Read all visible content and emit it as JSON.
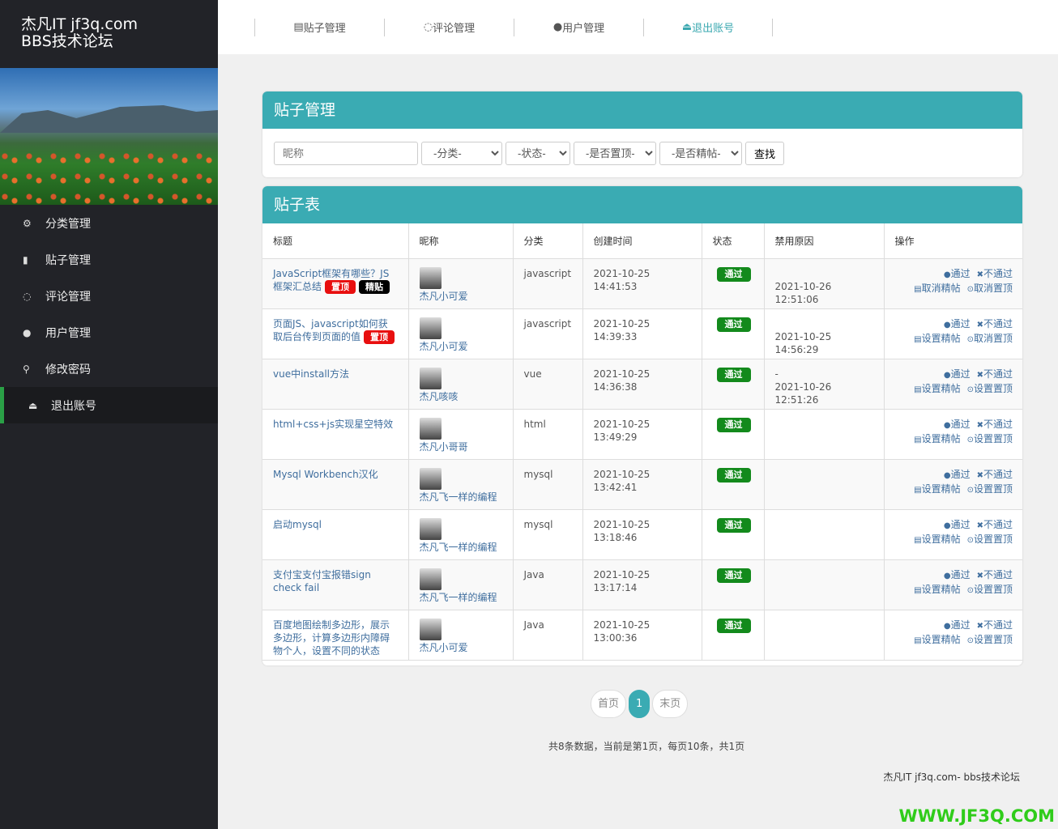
{
  "brand": {
    "line1": "杰凡IT jf3q.com",
    "line2": "BBS技术论坛"
  },
  "sidebar": {
    "items": [
      {
        "label": "分类管理",
        "icon": "⚙"
      },
      {
        "label": "贴子管理",
        "icon": "▮"
      },
      {
        "label": "评论管理",
        "icon": "◌"
      },
      {
        "label": "用户管理",
        "icon": "●"
      },
      {
        "label": "修改密码",
        "icon": "⚲"
      },
      {
        "label": "退出账号",
        "icon": "⏏"
      }
    ]
  },
  "topnav": [
    {
      "label": "贴子管理",
      "icon": "▤"
    },
    {
      "label": "评论管理",
      "icon": "◌"
    },
    {
      "label": "用户管理",
      "icon": "●"
    },
    {
      "label": "退出账号",
      "icon": "⏏"
    }
  ],
  "search": {
    "title": "贴子管理",
    "nickname_placeholder": "昵称",
    "category": "-分类-",
    "status": "-状态-",
    "top": "-是否置顶-",
    "essence": "-是否精帖-",
    "button": "查找"
  },
  "table": {
    "title": "贴子表",
    "headers": [
      "标题",
      "昵称",
      "分类",
      "创建时间",
      "状态",
      "禁用原因",
      "操作"
    ],
    "rows": [
      {
        "title": "JavaScript框架有哪些？JS框架汇总结",
        "badges": [
          "置顶",
          "精贴"
        ],
        "nick": "杰凡小可爱",
        "cat": "javascript",
        "time": "2021-10-25 14:41:53",
        "status": "通过",
        "reason": "2021-10-26 12:51:06",
        "reason_prefix": "",
        "ops": [
          "通过",
          "不通过",
          "取消精帖",
          "取消置顶"
        ]
      },
      {
        "title": "页面JS、javascript如何获取后台传到页面的值",
        "badges": [
          "置顶"
        ],
        "nick": "杰凡小可爱",
        "cat": "javascript",
        "time": "2021-10-25 14:39:33",
        "status": "通过",
        "reason": "2021-10-25 14:56:29",
        "reason_prefix": "",
        "ops": [
          "通过",
          "不通过",
          "设置精帖",
          "取消置顶"
        ]
      },
      {
        "title": "vue中install方法",
        "badges": [],
        "nick": "杰凡咳咳",
        "cat": "vue",
        "time": "2021-10-25 14:36:38",
        "status": "通过",
        "reason": "2021-10-26 12:51:26",
        "reason_prefix": "-",
        "ops": [
          "通过",
          "不通过",
          "设置精帖",
          "设置置顶"
        ]
      },
      {
        "title": "html+css+js实现星空特效",
        "badges": [],
        "nick": "杰凡小哥哥",
        "cat": "html",
        "time": "2021-10-25 13:49:29",
        "status": "通过",
        "reason": "",
        "reason_prefix": "",
        "ops": [
          "通过",
          "不通过",
          "设置精帖",
          "设置置顶"
        ]
      },
      {
        "title": "Mysql Workbench汉化",
        "badges": [],
        "nick": "杰凡飞一样的编程",
        "cat": "mysql",
        "time": "2021-10-25 13:42:41",
        "status": "通过",
        "reason": "",
        "reason_prefix": "",
        "ops": [
          "通过",
          "不通过",
          "设置精帖",
          "设置置顶"
        ]
      },
      {
        "title": "启动mysql",
        "badges": [],
        "nick": "杰凡飞一样的编程",
        "cat": "mysql",
        "time": "2021-10-25 13:18:46",
        "status": "通过",
        "reason": "",
        "reason_prefix": "",
        "ops": [
          "通过",
          "不通过",
          "设置精帖",
          "设置置顶"
        ]
      },
      {
        "title": "支付宝支付宝报错sign check fail",
        "badges": [],
        "nick": "杰凡飞一样的编程",
        "cat": "Java",
        "time": "2021-10-25 13:17:14",
        "status": "通过",
        "reason": "",
        "reason_prefix": "",
        "ops": [
          "通过",
          "不通过",
          "设置精帖",
          "设置置顶"
        ]
      },
      {
        "title": "百度地图绘制多边形，展示多边形，计算多边形内障碍物个人，设置不同的状态",
        "badges": [],
        "nick": "杰凡小可爱",
        "cat": "Java",
        "time": "2021-10-25 13:00:36",
        "status": "通过",
        "reason": "",
        "reason_prefix": "",
        "ops": [
          "通过",
          "不通过",
          "设置精帖",
          "设置置顶"
        ]
      }
    ]
  },
  "pager": {
    "first": "首页",
    "current": "1",
    "last": "末页",
    "summary": "共8条数据，当前是第1页，每页10条，共1页"
  },
  "footer": "杰凡IT jf3q.com- bbs技术论坛",
  "watermark": "WWW.JF3Q.COM"
}
